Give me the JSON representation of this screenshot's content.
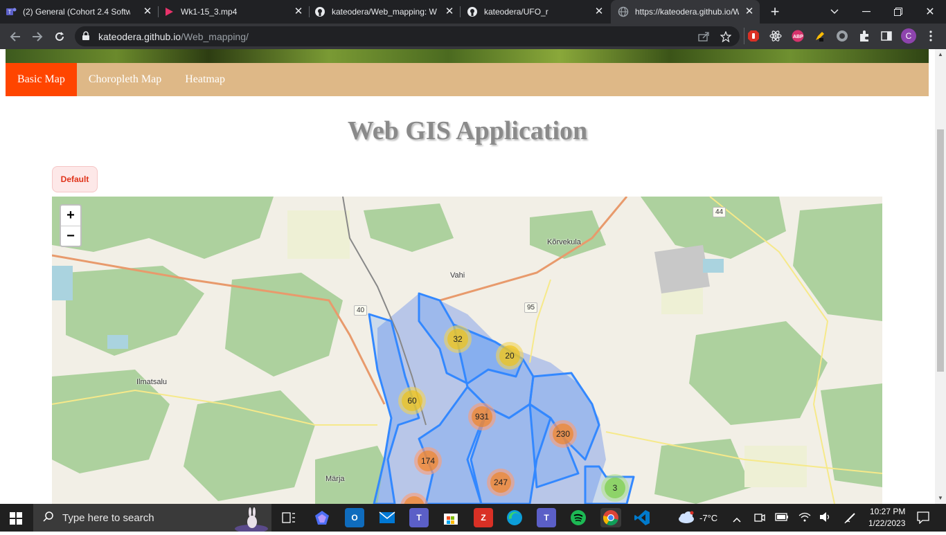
{
  "browser": {
    "tabs": [
      {
        "title": "(2) General (Cohort 2.4 Softw",
        "icon": "teams-icon",
        "active": false
      },
      {
        "title": "Wk1-15_3.mp4",
        "icon": "video-play-icon",
        "active": false
      },
      {
        "title": "kateodera/Web_mapping: W",
        "icon": "github-icon",
        "active": false
      },
      {
        "title": "kateodera/UFO_r",
        "icon": "github-icon",
        "active": false
      },
      {
        "title": "https://kateodera.github.io/W",
        "icon": "globe-icon",
        "active": true
      }
    ],
    "new_tab_label": "+",
    "url_host": "kateodera.github.io",
    "url_path": "/Web_mapping/",
    "profile_initial": "C",
    "ext_abp_label": "ABP"
  },
  "page": {
    "nav": {
      "items": [
        "Basic Map",
        "Choropleth Map",
        "Heatmap"
      ],
      "active_index": 0,
      "bg_color": "#deb887",
      "active_color": "#ff4500"
    },
    "title": "Web GIS Application",
    "default_button": "Default"
  },
  "map": {
    "zoom_in": "+",
    "zoom_out": "−",
    "place_labels": {
      "korvekula": "Kõrvekula",
      "vahi": "Vahi",
      "ilmatsalu": "Ilmatsalu",
      "marja": "Märja"
    },
    "road_shields": {
      "r44": "44",
      "r40": "40",
      "r95": "95"
    },
    "clusters": [
      {
        "count": "32",
        "size": "medium"
      },
      {
        "count": "20",
        "size": "medium"
      },
      {
        "count": "60",
        "size": "medium"
      },
      {
        "count": "931",
        "size": "large"
      },
      {
        "count": "230",
        "size": "large"
      },
      {
        "count": "174",
        "size": "large"
      },
      {
        "count": "247",
        "size": "large"
      },
      {
        "count": "3",
        "size": "small"
      }
    ]
  },
  "taskbar": {
    "search_placeholder": "Type here to search",
    "weather": "-7°C",
    "time": "10:27 PM",
    "date": "1/22/2023"
  }
}
